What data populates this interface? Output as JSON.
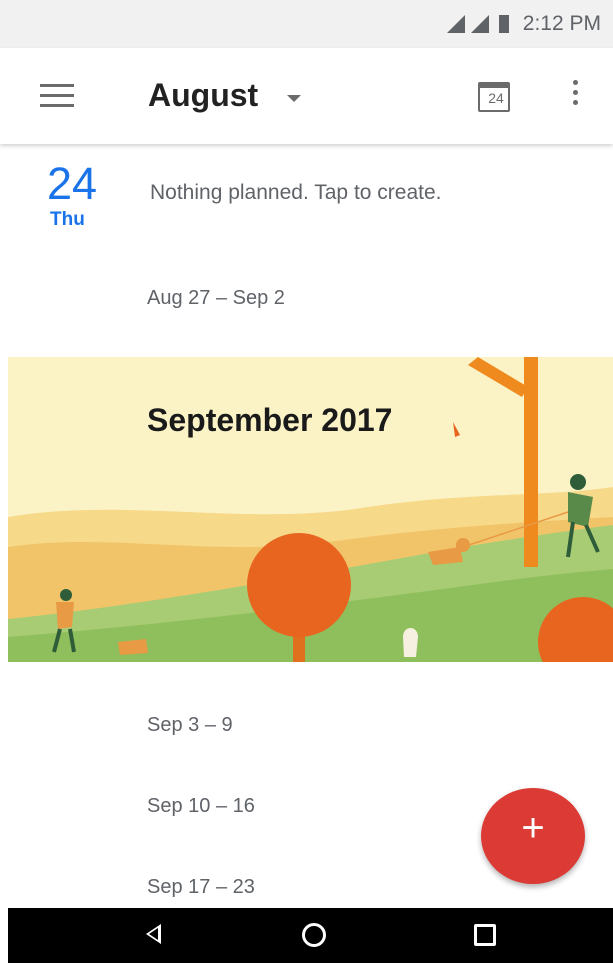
{
  "status_bar": {
    "time": "2:12 PM"
  },
  "app_bar": {
    "month": "August",
    "today_icon_number": "24"
  },
  "agenda": {
    "today": {
      "day_number": "24",
      "day_name": "Thu",
      "message": "Nothing planned. Tap to create."
    },
    "weeks_before": [
      "Aug 27 – Sep 2"
    ],
    "month_banner": "September 2017",
    "weeks_after": [
      "Sep 3 – 9",
      "Sep 10 – 16",
      "Sep 17 – 23"
    ]
  },
  "fab": {
    "label": "+"
  },
  "colors": {
    "accent": "#1a73e8",
    "fab": "#db3a35",
    "banner_bg": "#fbf3c6"
  },
  "icons": {
    "menu": "hamburger-menu-icon",
    "month_dropdown": "caret-down-icon",
    "today": "calendar-today-icon",
    "overflow": "more-vert-icon",
    "nav_back": "back-triangle-icon",
    "nav_home": "home-circle-icon",
    "nav_recents": "recents-square-icon"
  }
}
